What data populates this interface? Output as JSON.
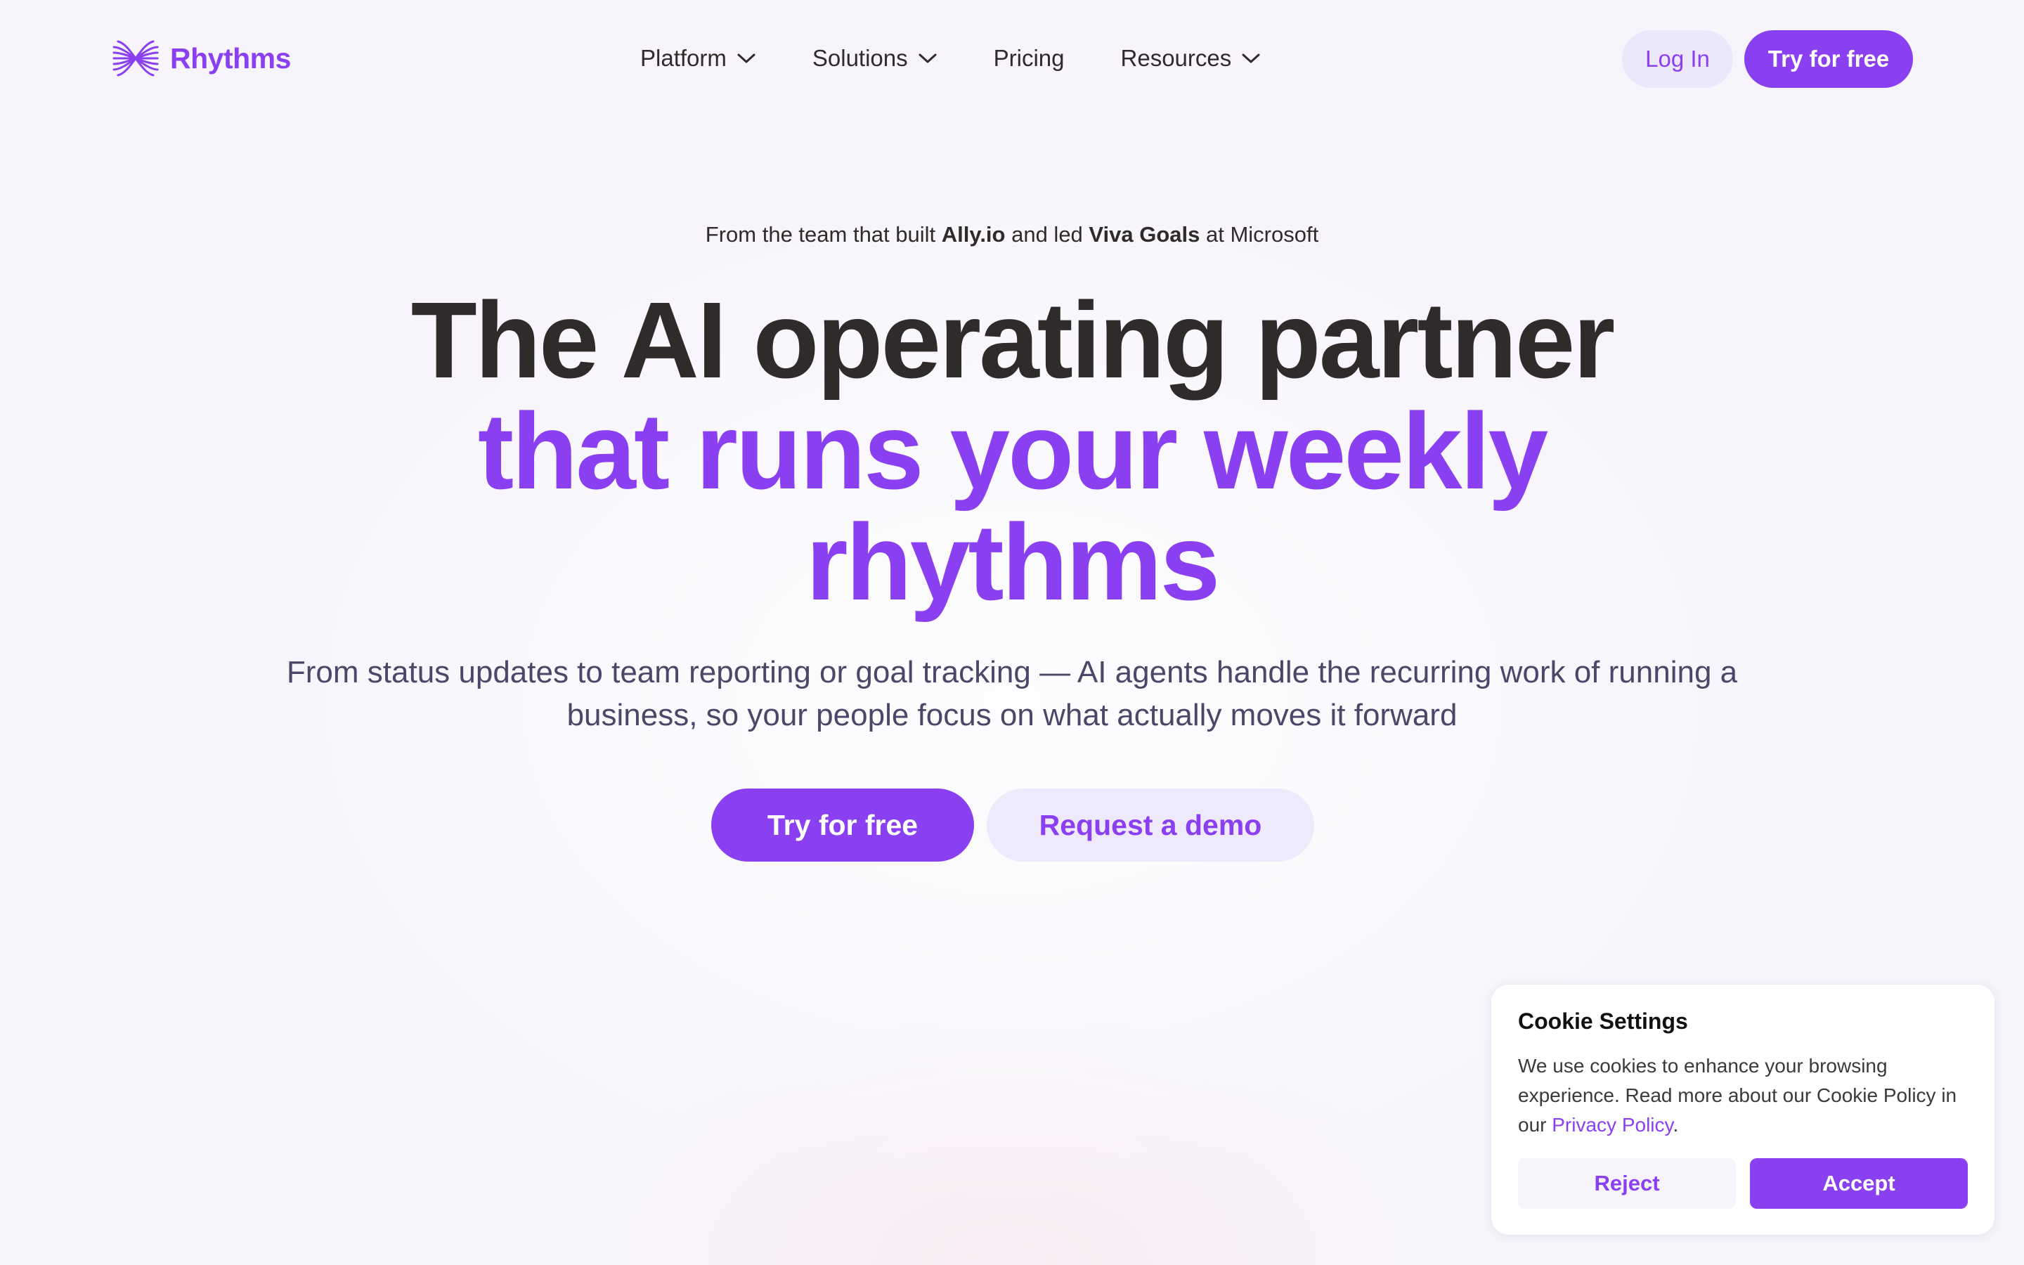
{
  "nav": {
    "brand_name": "Rhythms",
    "logo_icon": "rhythms-wave-logo",
    "items": [
      {
        "label": "Platform",
        "has_dropdown": true
      },
      {
        "label": "Solutions",
        "has_dropdown": true
      },
      {
        "label": "Pricing",
        "has_dropdown": false
      },
      {
        "label": "Resources",
        "has_dropdown": true
      }
    ],
    "login_label": "Log In",
    "try_label": "Try for free"
  },
  "hero": {
    "tagline_prefix": "From the team that built ",
    "tagline_brand1": "Ally.io",
    "tagline_mid": " and led ",
    "tagline_brand2": "Viva Goals",
    "tagline_suffix": " at Microsoft",
    "headline_line1": "The AI operating partner",
    "headline_line2": "that runs your weekly",
    "headline_line3": "rhythms",
    "subtext": "From status updates to team reporting or goal tracking — AI agents handle the recurring work of running a business, so your people focus on what actually moves it forward",
    "cta_primary": "Try for free",
    "cta_secondary": "Request a demo"
  },
  "cookie": {
    "title": "Cookie Settings",
    "text": "We use cookies to enhance your browsing experience. Read more about our Cookie Policy in our ",
    "link_text": "Privacy Policy",
    "text_end": ".",
    "reject_label": "Reject",
    "accept_label": "Accept"
  },
  "colors": {
    "accent": "#8a3ff0",
    "text_dark": "#2f2b2a",
    "text_muted": "#4c4769",
    "background": "#f7f5fb",
    "secondary_button_bg": "#eee9fb"
  }
}
